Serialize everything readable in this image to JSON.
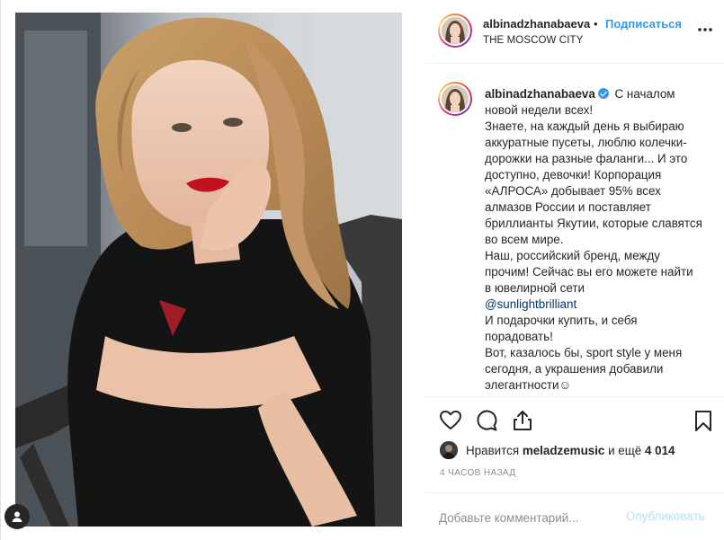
{
  "header": {
    "username": "albinadzhanabaeva",
    "separator": "•",
    "follow_label": "Подписаться",
    "location": "THE MOSCOW CITY",
    "more_icon": "more-horizontal-icon"
  },
  "caption": {
    "username": "albinadzhanabaeva",
    "text_before_mention": "С началом новой недели всех!\nЗнаете, на каждый день я выбираю аккуратные пусеты, люблю колечки-дорожки на разные фаланги... И это доступно, девочки! Корпорация «АЛРОСА» добывает 95% всех алмазов России и поставляет бриллианты Якутии, которые славятся во всем мире.\nНаш, российский бренд, между прочим! Сейчас вы его можете найти в ювелирной сети\n",
    "mention": "@sunlightbrilliant",
    "text_after_mention": "\nИ подарочки купить, и себя порадовать!\nВот, казалось бы, sport style у меня сегодня, а украшения добавили элегантности☺"
  },
  "actions": {
    "like_icon": "heart-icon",
    "comment_icon": "comment-icon",
    "share_icon": "share-icon",
    "save_icon": "bookmark-icon"
  },
  "likes": {
    "prefix": "Нравится",
    "user": "meladzemusic",
    "middle": "и ещё",
    "count": "4 014"
  },
  "timestamp": "4 ЧАСОВ НАЗАД",
  "comment": {
    "placeholder": "Добавьте комментарий...",
    "publish_label": "Опубликовать"
  },
  "colors": {
    "link_blue": "#3897f0",
    "mention_blue": "#003569",
    "publish_disabled": "#b2dffc",
    "muted": "#8e8e8e"
  }
}
